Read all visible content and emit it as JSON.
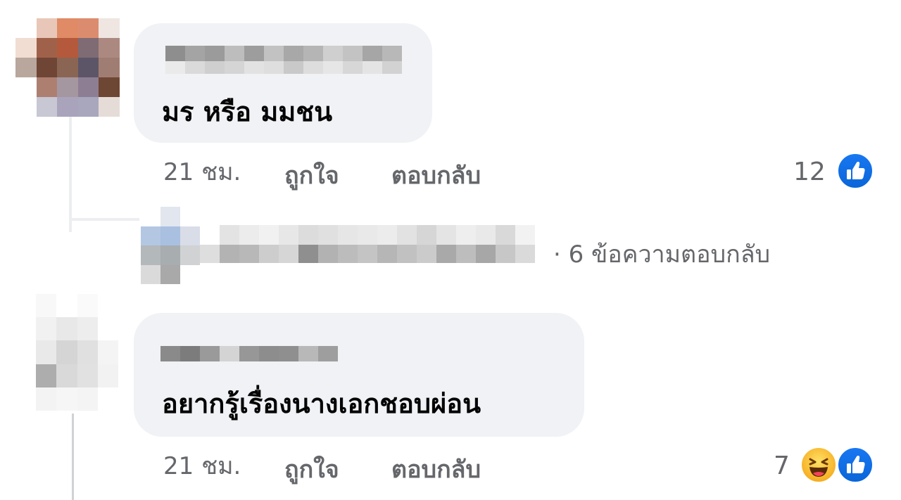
{
  "comments": [
    {
      "text": "มร หรือ มมชน",
      "time": "21 ชม.",
      "like_label": "ถูกใจ",
      "reply_label": "ตอบกลับ",
      "reaction_count": "12",
      "reactions": [
        "like-icon"
      ]
    },
    {
      "text": "อยากรู้เรื่องนางเอกชอบผ่อน",
      "time": "21 ชม.",
      "like_label": "ถูกใจ",
      "reply_label": "ตอบกลับ",
      "reaction_count": "7",
      "reactions": [
        "haha-icon",
        "like-icon"
      ]
    }
  ],
  "replies_summary": {
    "text": "· 6 ข้อความตอบกลับ"
  },
  "colors": {
    "bubble": "#f0f2f5",
    "meta_text": "#65676b",
    "like_blue": "#1877f2",
    "haha_yellow": "#f7b125"
  }
}
